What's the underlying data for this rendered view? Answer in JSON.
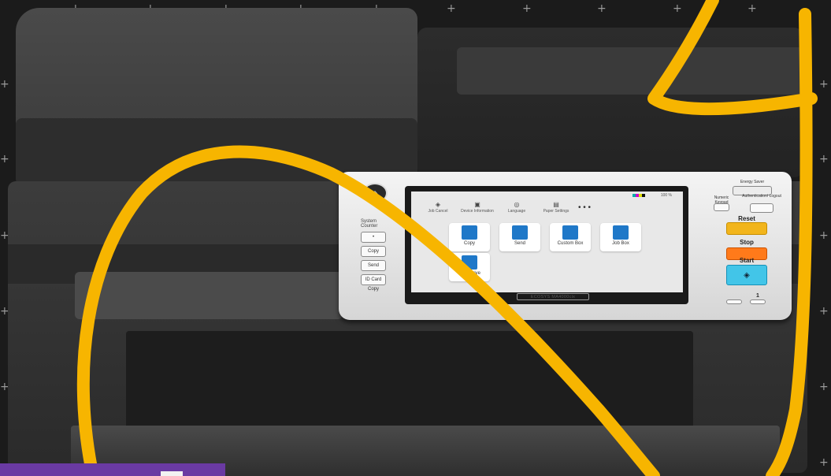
{
  "panel": {
    "status_pct": "100 %",
    "top_menu": [
      {
        "label": "Job Cancel",
        "icon": "job-cancel-icon"
      },
      {
        "label": "Device Information",
        "icon": "info-icon"
      },
      {
        "label": "Language",
        "icon": "language-icon"
      },
      {
        "label": "Paper Settings",
        "icon": "paper-icon"
      }
    ],
    "more": "• • •",
    "tiles": [
      {
        "label": "Copy",
        "icon": "copy-icon"
      },
      {
        "label": "Send",
        "icon": "send-icon"
      },
      {
        "label": "Custom Box",
        "icon": "folder-icon"
      },
      {
        "label": "Job Box",
        "icon": "job-box-icon"
      }
    ],
    "tile_row2": {
      "label": "USB Drive",
      "icon": "usb-drive-icon"
    },
    "model": "ECOSYS MA4000cix",
    "left_keys": {
      "system_label": "System Counter",
      "copy": "Copy",
      "send": "Send",
      "id_card": "ID Card Copy"
    },
    "right_keys": {
      "energy_saver": "Energy Saver",
      "numeric_keypad": "Numeric Keypad",
      "authentication": "Authentication/ Logout",
      "reset": "Reset",
      "stop": "Stop",
      "start": "Start",
      "one": "1"
    }
  },
  "colors": {
    "scribble": "#f7b500",
    "start_key": "#42c5e8",
    "reset_key": "#f2b51c",
    "stop_key": "#ff7a1a",
    "banner": "#6a3aa3"
  }
}
